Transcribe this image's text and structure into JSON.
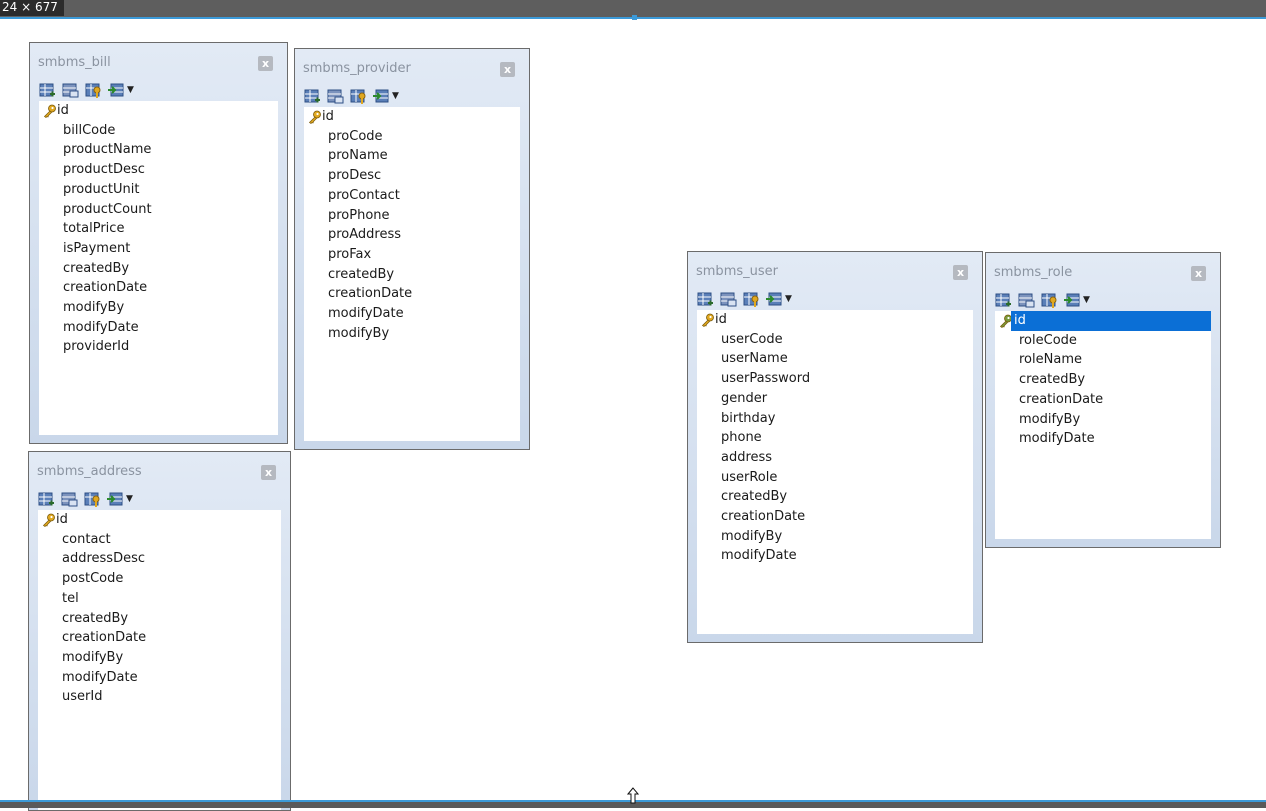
{
  "window": {
    "dimension_label": "24 × 677"
  },
  "colors": {
    "accent": "#3c9ad8",
    "selection": "#0b6fd6",
    "key_gold": "#e0a820",
    "key_green": "#7a9a3a"
  },
  "tables": {
    "bill": {
      "name": "smbms_bill",
      "fields": [
        "id",
        "billCode",
        "productName",
        "productDesc",
        "productUnit",
        "productCount",
        "totalPrice",
        "isPayment",
        "createdBy",
        "creationDate",
        "modifyBy",
        "modifyDate",
        "providerId"
      ]
    },
    "provider": {
      "name": "smbms_provider",
      "fields": [
        "id",
        "proCode",
        "proName",
        "proDesc",
        "proContact",
        "proPhone",
        "proAddress",
        "proFax",
        "createdBy",
        "creationDate",
        "modifyDate",
        "modifyBy"
      ]
    },
    "address": {
      "name": "smbms_address",
      "fields": [
        "id",
        "contact",
        "addressDesc",
        "postCode",
        "tel",
        "createdBy",
        "creationDate",
        "modifyBy",
        "modifyDate",
        "userId"
      ]
    },
    "user": {
      "name": "smbms_user",
      "fields": [
        "id",
        "userCode",
        "userName",
        "userPassword",
        "gender",
        "birthday",
        "phone",
        "address",
        "userRole",
        "createdBy",
        "creationDate",
        "modifyBy",
        "modifyDate"
      ]
    },
    "role": {
      "name": "smbms_role",
      "fields": [
        "id",
        "roleCode",
        "roleName",
        "createdBy",
        "creationDate",
        "modifyBy",
        "modifyDate"
      ],
      "selected_field": "id"
    }
  },
  "toolbar_icons": [
    "add-field-icon",
    "remove-field-icon",
    "key-field-icon",
    "insert-field-icon"
  ],
  "close_glyph": "x"
}
